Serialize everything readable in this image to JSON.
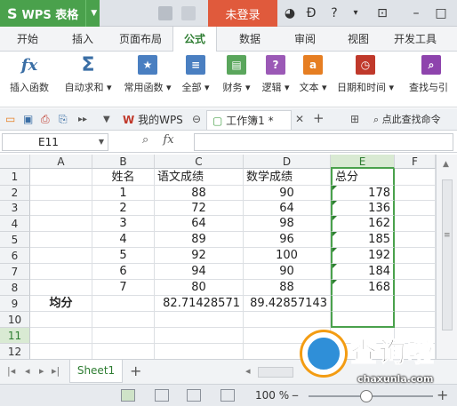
{
  "app": {
    "name": "WPS 表格",
    "login_label": "未登录"
  },
  "ribbon_tabs": [
    "开始",
    "插入",
    "页面布局",
    "公式",
    "数据",
    "审阅",
    "视图",
    "开发工具"
  ],
  "ribbon_buttons": [
    {
      "icon": "fx-icon",
      "label": "插入函数",
      "color": "#3a6ea5"
    },
    {
      "icon": "sum-icon",
      "label": "自动求和 ▾",
      "color": "#3a6ea5"
    },
    {
      "icon": "star-book-icon",
      "label": "常用函数 ▾",
      "color": "#4a7fc1"
    },
    {
      "icon": "book-all-icon",
      "label": "全部 ▾",
      "color": "#4a7fc1"
    },
    {
      "icon": "finance-book-icon",
      "label": "财务 ▾",
      "color": "#5aa65c"
    },
    {
      "icon": "logic-book-icon",
      "label": "逻辑 ▾",
      "color": "#9b59b6"
    },
    {
      "icon": "text-book-icon",
      "label": "文本 ▾",
      "color": "#e67e22"
    },
    {
      "icon": "datetime-book-icon",
      "label": "日期和时间 ▾",
      "color": "#c0392b"
    },
    {
      "icon": "lookup-book-icon",
      "label": "查找与引",
      "color": "#8e44ad"
    }
  ],
  "doc_tabs": {
    "home": "我的WPS",
    "workbook": "工作簿1 *",
    "find": "点此查找命令"
  },
  "formula_bar": {
    "name_box": "E11",
    "fx": "fx"
  },
  "columns": [
    "A",
    "B",
    "C",
    "D",
    "E",
    "F"
  ],
  "rows": [
    "1",
    "2",
    "3",
    "4",
    "5",
    "6",
    "7",
    "8",
    "9",
    "10",
    "11",
    "12"
  ],
  "cells": {
    "header": {
      "b": "姓名",
      "c": "语文成绩",
      "d": "数学成绩",
      "e": "总分"
    },
    "data": [
      {
        "b": "1",
        "c": "88",
        "d": "90",
        "e": "178"
      },
      {
        "b": "2",
        "c": "72",
        "d": "64",
        "e": "136"
      },
      {
        "b": "3",
        "c": "64",
        "d": "98",
        "e": "162"
      },
      {
        "b": "4",
        "c": "89",
        "d": "96",
        "e": "185"
      },
      {
        "b": "5",
        "c": "92",
        "d": "100",
        "e": "192"
      },
      {
        "b": "6",
        "c": "94",
        "d": "90",
        "e": "184"
      },
      {
        "b": "7",
        "c": "80",
        "d": "88",
        "e": "168"
      }
    ],
    "avg": {
      "a": "均分",
      "c": "82.71428571",
      "d": "89.42857143"
    }
  },
  "sheet_tab": "Sheet1",
  "status": {
    "zoom": "100 %"
  },
  "watermark": {
    "text": "查询啦",
    "url": "chaxunla.com"
  },
  "colors": {
    "accent": "#4aa14c",
    "login": "#e05a3c",
    "selection": "#d9ead3"
  }
}
